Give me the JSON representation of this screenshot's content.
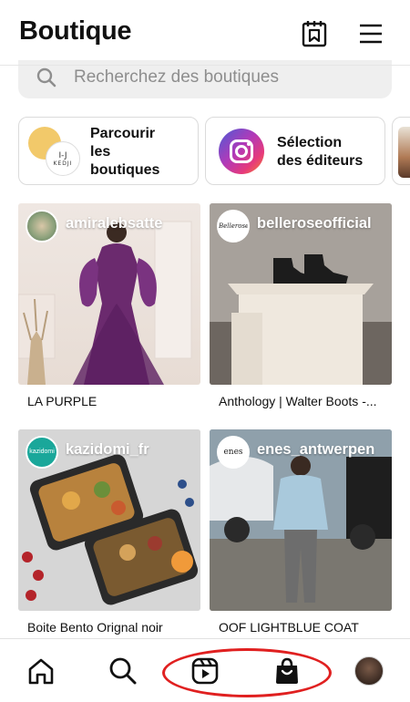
{
  "header": {
    "title": "Boutique",
    "wishlist_icon": "wishlist-icon",
    "menu_icon": "menu-icon"
  },
  "search": {
    "placeholder": "Recherchez des boutiques",
    "icon": "search-icon"
  },
  "chips": [
    {
      "label": "Parcourir les boutiques",
      "line1": "Parcourir",
      "line2": "les",
      "line3": "boutiques",
      "logo_text": "I-J",
      "logo_sub": "KEDJI"
    },
    {
      "label": "Sélection des éditeurs",
      "line1": "Sélection",
      "line2": "des éditeurs",
      "icon": "instagram-icon"
    },
    {
      "label": ""
    }
  ],
  "cards": [
    {
      "handle": "amiralebsatte",
      "caption": "LA PURPLE"
    },
    {
      "handle": "belleroseofficial",
      "caption": "Anthology | Walter Boots -...",
      "avatar_text": "Bellerose"
    },
    {
      "handle": "kazidomi_fr",
      "caption": "Boite Bento Orignal noir",
      "avatar_text": "kazidomi"
    },
    {
      "handle": "enes_antwerpen",
      "caption": "OOF LIGHTBLUE COAT",
      "avatar_text": "enes"
    }
  ],
  "nav": {
    "items": [
      "home-icon",
      "search-icon",
      "reels-icon",
      "shop-icon",
      "profile-avatar"
    ],
    "highlight_color": "#e02020"
  }
}
